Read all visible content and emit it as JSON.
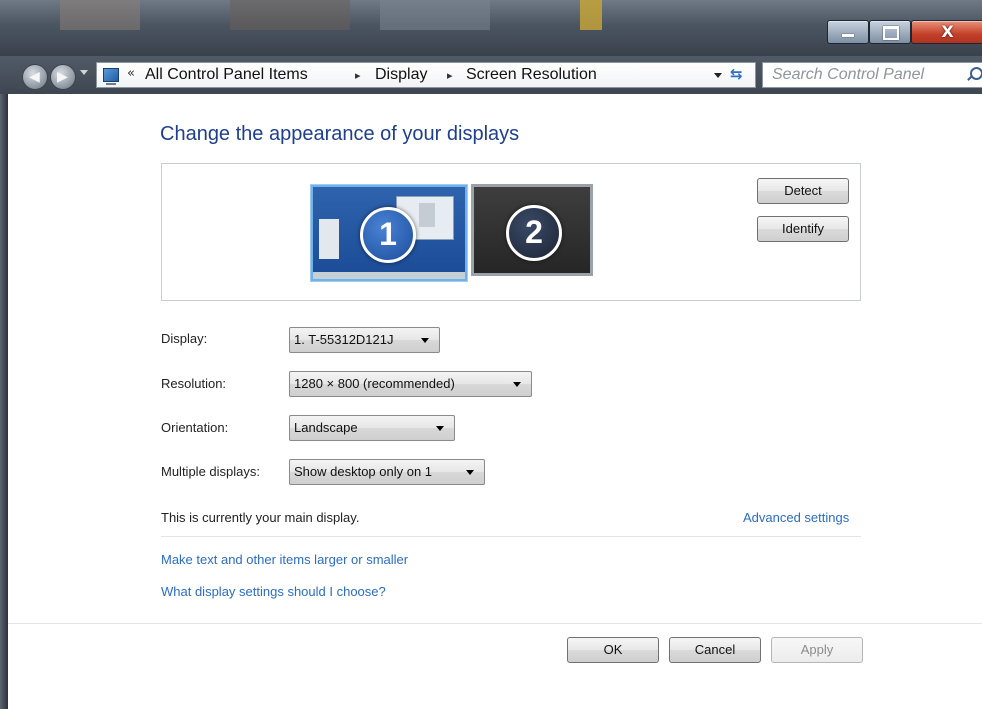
{
  "window": {
    "controls": {
      "minimize": "minimize",
      "maximize": "maximize",
      "close": "X"
    }
  },
  "address_bar": {
    "overflow": "«",
    "breadcrumbs": [
      "All Control Panel Items",
      "Display",
      "Screen Resolution"
    ],
    "separator": "▸"
  },
  "search": {
    "placeholder": "Search Control Panel"
  },
  "main": {
    "title": "Change the appearance of your displays",
    "monitors": [
      {
        "number": "1",
        "selected": true
      },
      {
        "number": "2",
        "selected": false
      }
    ],
    "detect_label": "Detect",
    "identify_label": "Identify",
    "fields": {
      "display": {
        "label": "Display:",
        "value": "1. T-55312D121J"
      },
      "resolution": {
        "label": "Resolution:",
        "value": "1280 × 800 (recommended)"
      },
      "orientation": {
        "label": "Orientation:",
        "value": "Landscape"
      },
      "multiple": {
        "label": "Multiple displays:",
        "value": "Show desktop only on 1"
      }
    },
    "status": "This is currently your main display.",
    "advanced_link": "Advanced settings",
    "links": [
      "Make text and other items larger or smaller",
      "What display settings should I choose?"
    ]
  },
  "footer": {
    "ok": "OK",
    "cancel": "Cancel",
    "apply": "Apply"
  },
  "colors": {
    "title": "#1e3e8f",
    "link": "#2b6cc4",
    "selected_monitor": "#2f63ad",
    "close_button": "#c3402a"
  }
}
